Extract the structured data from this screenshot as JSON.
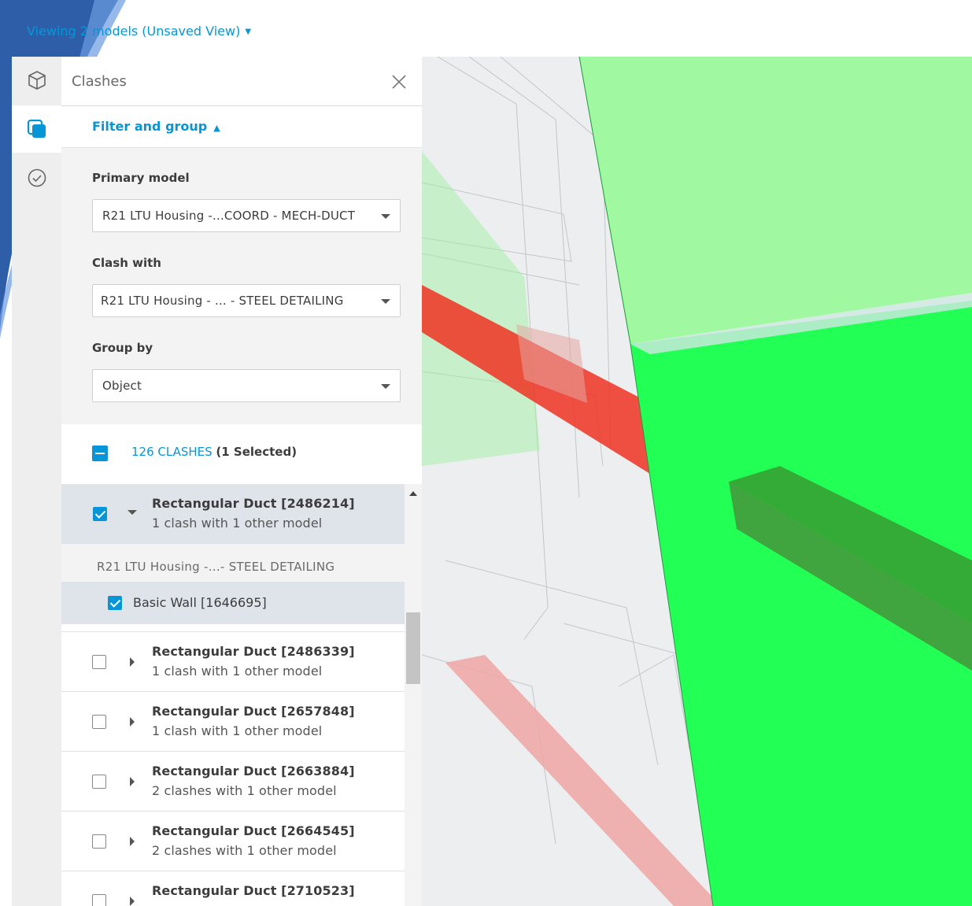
{
  "header": {
    "view_title": "Viewing 2 models (Unsaved View)"
  },
  "rail": {
    "items": [
      {
        "icon": "cube-icon",
        "active": false
      },
      {
        "icon": "clashes-icon",
        "active": true
      },
      {
        "icon": "check-circle-icon",
        "active": false
      }
    ]
  },
  "panel": {
    "title": "Clashes",
    "filter_toggle": "Filter and group",
    "primary_model": {
      "label": "Primary model",
      "value": "R21 LTU Housing -...COORD - MECH-DUCT"
    },
    "clash_with": {
      "label": "Clash with",
      "value": "R21 LTU Housing - ... - STEEL DETAILING"
    },
    "group_by": {
      "label": "Group by",
      "value": "Object"
    },
    "clashes_link": "126 CLASHES",
    "selected_text": "(1 Selected)"
  },
  "list": {
    "expanded_model": "R21 LTU Housing -...- STEEL DETAILING",
    "sub_item": "Basic Wall [1646695]",
    "items": [
      {
        "title": "Rectangular Duct [2486214]",
        "subtitle": "1 clash with 1 other model"
      },
      {
        "title": "Rectangular Duct [2486339]",
        "subtitle": "1 clash with 1 other model"
      },
      {
        "title": "Rectangular Duct [2657848]",
        "subtitle": "1 clash with 1 other model"
      },
      {
        "title": "Rectangular Duct [2663884]",
        "subtitle": "2 clashes with 1 other model"
      },
      {
        "title": "Rectangular Duct [2664545]",
        "subtitle": "2 clashes with 1 other model"
      },
      {
        "title": "Rectangular Duct [2710523]",
        "subtitle": ""
      }
    ]
  },
  "colors": {
    "accent": "#0696d7",
    "clash_green": "#22ff55",
    "clash_red": "#ee3322"
  }
}
